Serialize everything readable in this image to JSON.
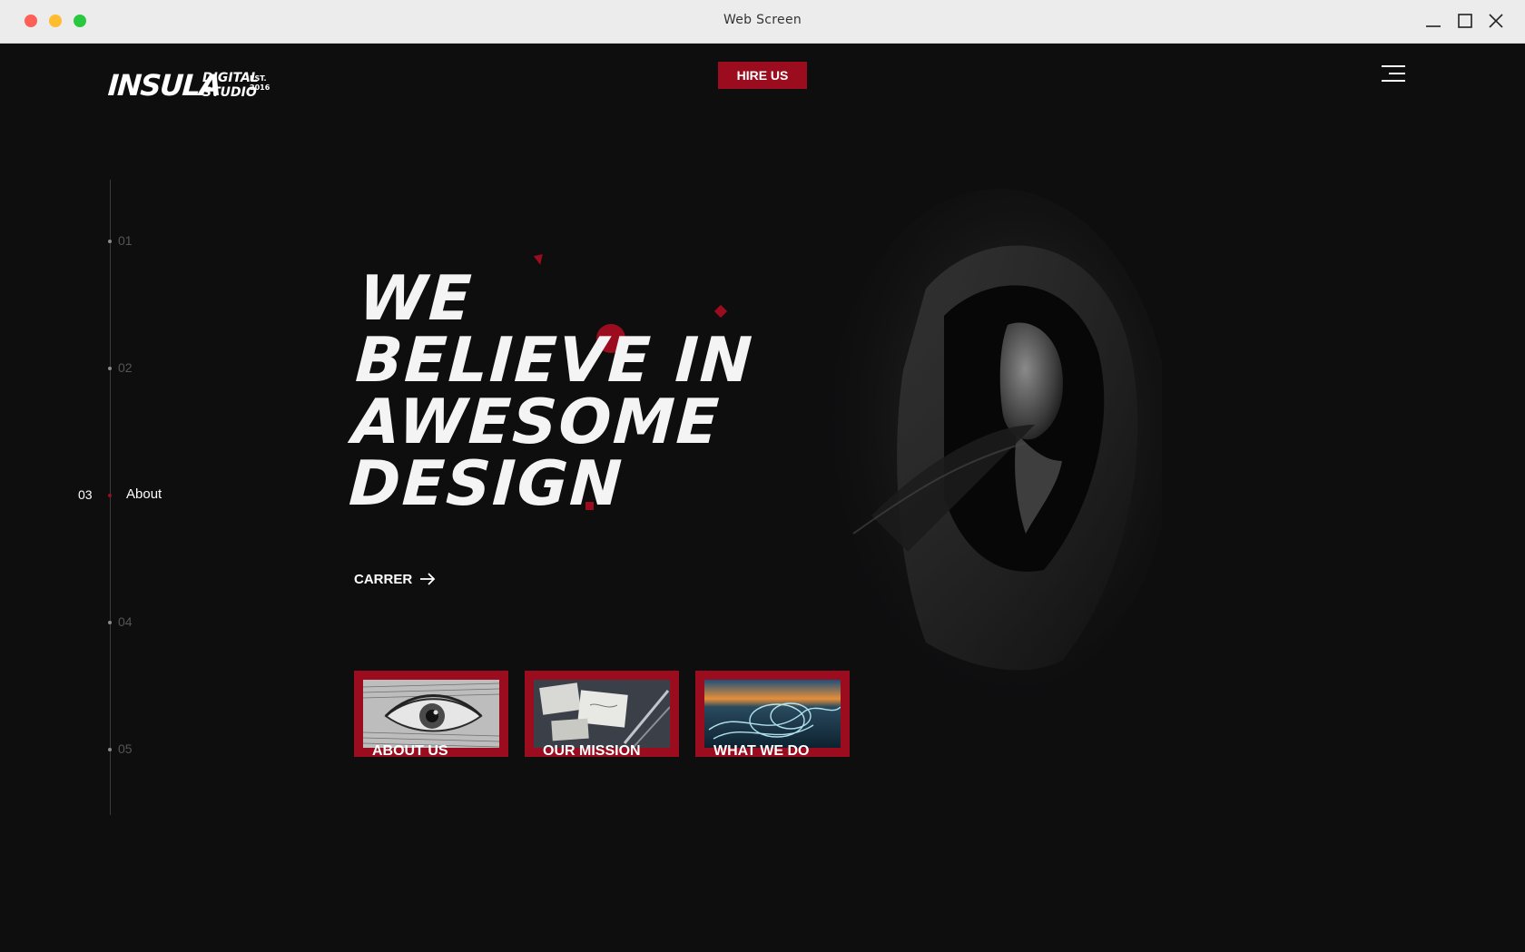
{
  "window": {
    "title": "Web Screen"
  },
  "brand": {
    "logo_main": "INSULA",
    "logo_sub": "DIGITAL STUDIO",
    "logo_est": "EST. 2016"
  },
  "header": {
    "hire_label": "HIRE US",
    "menu_icon": "hamburger-menu-icon"
  },
  "sidenav": {
    "items": [
      {
        "number": "01",
        "label": ""
      },
      {
        "number": "02",
        "label": ""
      },
      {
        "number": "03",
        "label": "About",
        "active": true
      },
      {
        "number": "04",
        "label": ""
      },
      {
        "number": "05",
        "label": ""
      }
    ]
  },
  "hero": {
    "headline_lines": [
      "WE",
      "BELIEVE IN",
      "AWESOME",
      "DESIGN"
    ],
    "career_label": "CARRER",
    "career_icon": "arrow-right-icon"
  },
  "cards": [
    {
      "label": "ABOUT US",
      "image": "eye-engraving"
    },
    {
      "label": "OUR MISSION",
      "image": "stationery-desk"
    },
    {
      "label": "WHAT WE DO",
      "image": "light-trails-landscape"
    }
  ],
  "colors": {
    "accent": "#9b0d1e",
    "background": "#0e0e0f",
    "text": "#ffffff"
  }
}
